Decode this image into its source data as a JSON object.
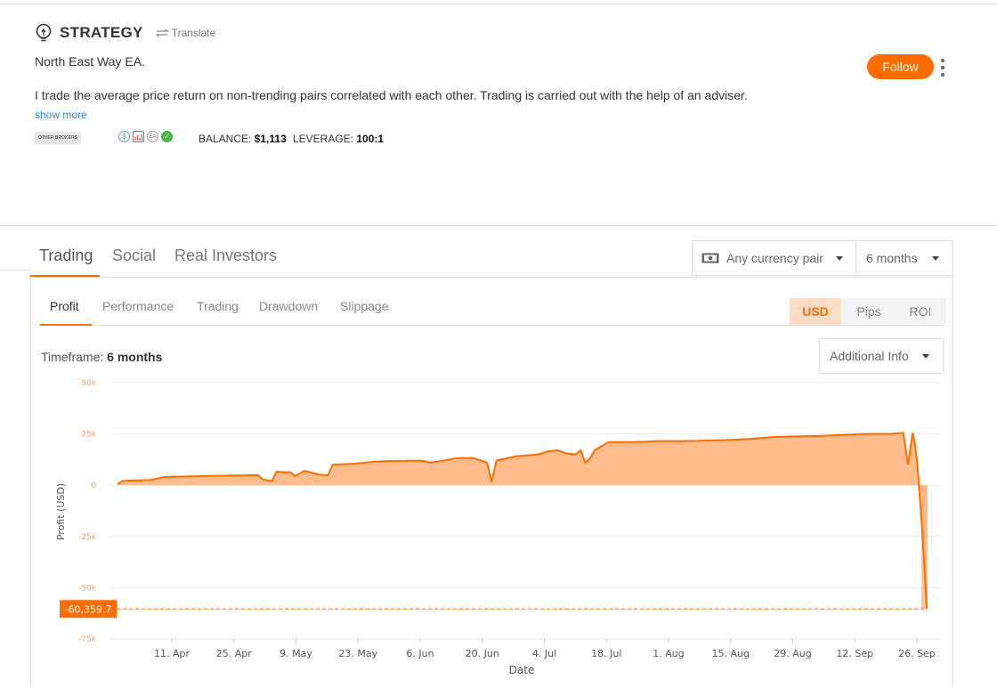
{
  "strategy": {
    "title": "STRATEGY",
    "translate_label": "Translate",
    "name": "North East Way EA.",
    "description": "I trade the average price return on non-trending pairs correlated with each other. Trading is carried out with the help of an adviser.",
    "show_more": "show more",
    "broker_badge": "OTHER BROKERS",
    "badge_icons": [
      "dollar-icon",
      "chart-icon",
      "ea-icon",
      "verified-check-icon"
    ],
    "balance_label": "BALANCE:",
    "balance_value": "$1,113",
    "leverage_label": "LEVERAGE:",
    "leverage_value": "100:1"
  },
  "actions": {
    "follow": "Follow"
  },
  "main_tabs": [
    {
      "label": "Trading",
      "active": true
    },
    {
      "label": "Social"
    },
    {
      "label": "Real Investors"
    }
  ],
  "filters": {
    "currency_pair": "Any currency pair",
    "period": "6 months"
  },
  "sub_tabs": [
    {
      "label": "Profit",
      "active": true
    },
    {
      "label": "Performance"
    },
    {
      "label": "Trading"
    },
    {
      "label": "Drawdown"
    },
    {
      "label": "Slippage"
    }
  ],
  "units": [
    {
      "label": "USD",
      "active": true
    },
    {
      "label": "Pips"
    },
    {
      "label": "ROI"
    }
  ],
  "timeframe": {
    "label": "Timeframe:",
    "value": "6 months"
  },
  "additional_info": "Additional Info",
  "colors": {
    "accent": "#ff6d00",
    "area_fill": "#ffb27a",
    "verified": "#4bb543"
  },
  "chart_data": {
    "type": "area",
    "xlabel": "Date",
    "ylabel": "Profit (USD)",
    "ylim": [
      -75000,
      50000
    ],
    "yticks": [
      "50k",
      "25k",
      "0",
      "-25k",
      "-50k",
      "-75k"
    ],
    "ytick_values": [
      50000,
      25000,
      0,
      -25000,
      -50000,
      -75000
    ],
    "xticks": [
      "11. Apr",
      "25. Apr",
      "9. May",
      "23. May",
      "6. Jun",
      "20. Jun",
      "4. Jul",
      "18. Jul",
      "1. Aug",
      "15. Aug",
      "29. Aug",
      "12. Sep",
      "26. Sep"
    ],
    "current_value_label": "-60,359.7",
    "current_value": -60359.7,
    "x_days": [
      0,
      1,
      2,
      7,
      10,
      14,
      20,
      28,
      30,
      31,
      33,
      34,
      37,
      38,
      40,
      43,
      45,
      46,
      51,
      53,
      55,
      58,
      65,
      67,
      71,
      72,
      73,
      76,
      79,
      80,
      81,
      85,
      90,
      92,
      94,
      96,
      98,
      99,
      100,
      101,
      102,
      105,
      110,
      113,
      115,
      120,
      125,
      130,
      135,
      140,
      145,
      150,
      155,
      160,
      165,
      168,
      169,
      170,
      170.5,
      171,
      172,
      172.5,
      173
    ],
    "values": [
      500,
      2000,
      2200,
      2500,
      4000,
      4200,
      4500,
      4800,
      5000,
      2800,
      2000,
      6500,
      6200,
      4500,
      7000,
      5200,
      4800,
      10000,
      10500,
      11000,
      11500,
      11800,
      12000,
      11000,
      12500,
      13000,
      13200,
      13300,
      11000,
      1500,
      12000,
      14000,
      15000,
      16500,
      17000,
      15500,
      15000,
      17000,
      11000,
      13000,
      17000,
      21000,
      21000,
      21200,
      21500,
      21500,
      21700,
      22000,
      22500,
      23500,
      23800,
      24000,
      24500,
      25000,
      25000,
      25500,
      10000,
      25500,
      20000,
      10000,
      -20000,
      -40000,
      -60359.7
    ]
  }
}
